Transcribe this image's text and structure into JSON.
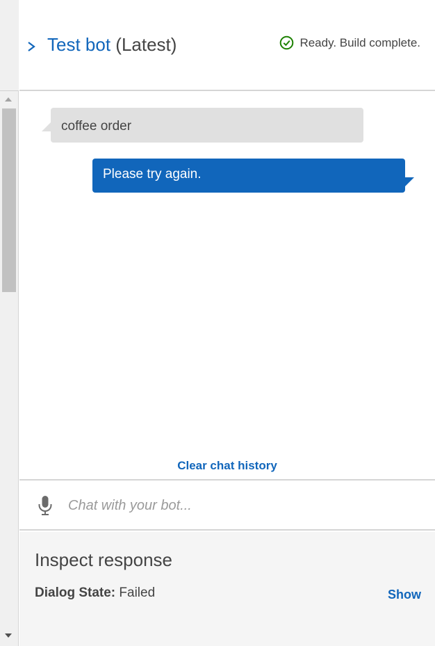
{
  "header": {
    "bot_name": "Test bot",
    "version": "(Latest)",
    "status_text": "Ready. Build complete.",
    "status_icon": "check-circle-icon",
    "expand_icon": "chevron-right-icon"
  },
  "chat": {
    "messages": [
      {
        "from": "user",
        "text": "coffee order"
      },
      {
        "from": "bot",
        "text": "Please try again."
      }
    ],
    "clear_label": "Clear chat history"
  },
  "input": {
    "placeholder": "Chat with your bot...",
    "mic_icon": "microphone-icon"
  },
  "inspect": {
    "title": "Inspect response",
    "dialog_state_label": "Dialog State:",
    "dialog_state_value": "Failed",
    "show_label": "Show"
  },
  "colors": {
    "accent": "#1166bb",
    "success": "#1d8102",
    "user_bubble": "#e0e0e0",
    "panel_bg": "#f5f5f5"
  }
}
